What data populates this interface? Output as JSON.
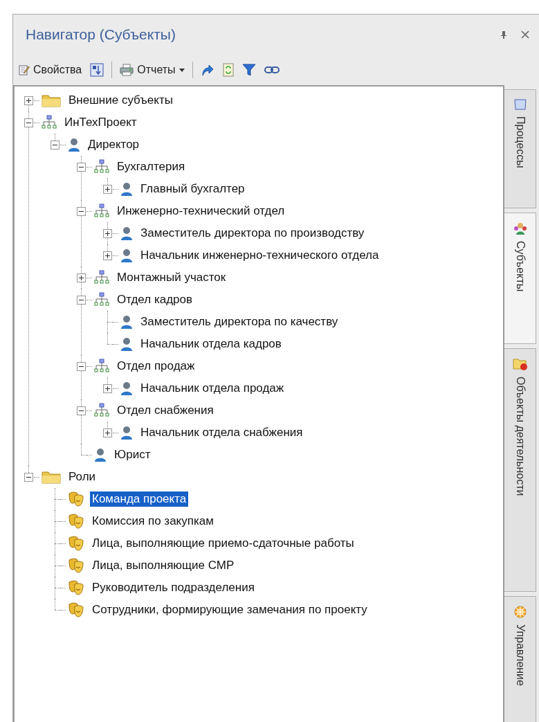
{
  "panel": {
    "title": "Навигатор (Субъекты)"
  },
  "toolbar": [
    {
      "kind": "button",
      "label": "Свойства"
    },
    {
      "kind": "icon"
    },
    {
      "kind": "separator"
    },
    {
      "kind": "menu",
      "label": "Отчеты"
    },
    {
      "kind": "separator"
    },
    {
      "kind": "icon"
    },
    {
      "kind": "icon"
    },
    {
      "kind": "icon"
    },
    {
      "kind": "icon"
    }
  ],
  "tree": [
    {
      "label": "Внешние субъекты",
      "kind": "folder",
      "expandable": true,
      "expanded": false,
      "selected": false
    },
    {
      "label": "ИнТехПроект",
      "kind": "org",
      "expandable": true,
      "expanded": true,
      "selected": false,
      "children": [
        {
          "label": "Директор",
          "kind": "person",
          "expandable": true,
          "expanded": true,
          "selected": false,
          "children": [
            {
              "label": "Бухгалтерия",
              "kind": "org",
              "expandable": true,
              "expanded": true,
              "selected": false,
              "children": [
                {
                  "label": "Главный бухгалтер",
                  "kind": "person",
                  "expandable": true,
                  "expanded": false,
                  "selected": false
                }
              ]
            },
            {
              "label": "Инженерно-технический отдел",
              "kind": "org",
              "expandable": true,
              "expanded": true,
              "selected": false,
              "children": [
                {
                  "label": "Заместитель директора по производству",
                  "kind": "person",
                  "expandable": true,
                  "expanded": false,
                  "selected": false
                },
                {
                  "label": "Начальник инженерно-технического отдела",
                  "kind": "person",
                  "expandable": true,
                  "expanded": false,
                  "selected": false
                }
              ]
            },
            {
              "label": "Монтажный участок",
              "kind": "org",
              "expandable": true,
              "expanded": false,
              "selected": false
            },
            {
              "label": "Отдел кадров",
              "kind": "org",
              "expandable": true,
              "expanded": true,
              "selected": false,
              "children": [
                {
                  "label": "Заместитель директора по качеству",
                  "kind": "person",
                  "expandable": false,
                  "selected": false
                },
                {
                  "label": "Начальник отдела кадров",
                  "kind": "person",
                  "expandable": false,
                  "selected": false
                }
              ]
            },
            {
              "label": "Отдел продаж",
              "kind": "org",
              "expandable": true,
              "expanded": true,
              "selected": false,
              "children": [
                {
                  "label": "Начальник отдела продаж",
                  "kind": "person",
                  "expandable": true,
                  "expanded": false,
                  "selected": false
                }
              ]
            },
            {
              "label": "Отдел снабжения",
              "kind": "org",
              "expandable": true,
              "expanded": true,
              "selected": false,
              "children": [
                {
                  "label": "Начальник отдела снабжения",
                  "kind": "person",
                  "expandable": true,
                  "expanded": false,
                  "selected": false
                }
              ]
            },
            {
              "label": "Юрист",
              "kind": "person",
              "expandable": false,
              "selected": false
            }
          ]
        }
      ]
    },
    {
      "label": "Роли",
      "kind": "folder",
      "expandable": true,
      "expanded": true,
      "selected": false,
      "children": [
        {
          "label": "Команда проекта",
          "kind": "role",
          "expandable": false,
          "selected": true
        },
        {
          "label": "Комиссия по закупкам",
          "kind": "role",
          "expandable": false,
          "selected": false
        },
        {
          "label": "Лица, выполняющие приемо-сдаточные работы",
          "kind": "role",
          "expandable": false,
          "selected": false
        },
        {
          "label": "Лица, выполняющие СМР",
          "kind": "role",
          "expandable": false,
          "selected": false
        },
        {
          "label": "Руководитель подразделения",
          "kind": "role",
          "expandable": false,
          "selected": false
        },
        {
          "label": "Сотрудники, формирующие замечания по проекту",
          "kind": "role",
          "expandable": false,
          "selected": false
        }
      ]
    }
  ],
  "side_tabs": [
    {
      "label": "Процессы",
      "selected": false
    },
    {
      "label": "Субъекты",
      "selected": true
    },
    {
      "label": "Объекты деятельности",
      "selected": false
    },
    {
      "label": "Управление",
      "selected": false
    }
  ]
}
